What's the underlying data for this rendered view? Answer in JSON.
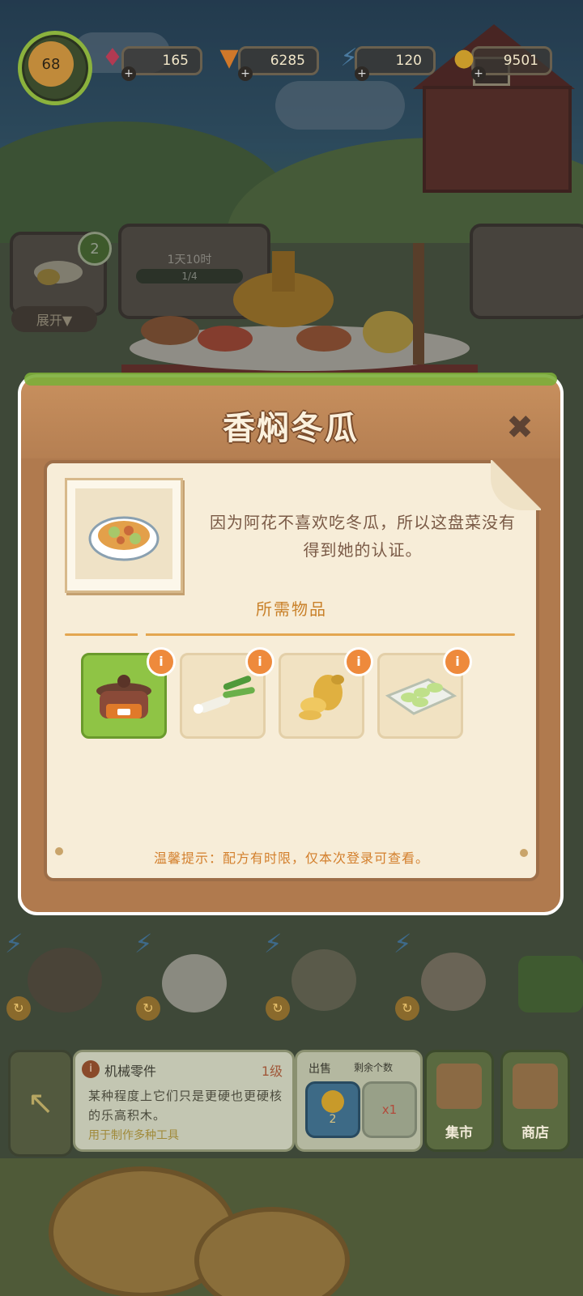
{
  "hud": {
    "level": "68",
    "gems": "165",
    "carrots": "6285",
    "energy": "120",
    "coins": "9501"
  },
  "background": {
    "expand_label": "展开▼",
    "notification_count": "2",
    "timer_text": "1天10时",
    "progress_text": "1/4"
  },
  "dialog": {
    "title": "香焖冬瓜",
    "close_icon": "close-icon",
    "dish_icon": "dish-icon",
    "description": "因为阿花不喜欢吃冬瓜，所以这盘菜没有得到她的认证。",
    "required_items_label": "所需物品",
    "required_items": [
      {
        "icon": "clay-pot-icon",
        "info": "i"
      },
      {
        "icon": "scallion-icon",
        "info": "i"
      },
      {
        "icon": "ginger-icon",
        "info": "i"
      },
      {
        "icon": "wintermelon-tray-icon",
        "info": "i"
      }
    ],
    "tip": "温馨提示：配方有时限，仅本次登录可查看。"
  },
  "bottom_panel": {
    "item_name": "机械零件",
    "item_level": "1级",
    "item_desc": "某种程度上它们只是更硬也更硬核的乐高积木。",
    "item_use": "用于制作多种工具",
    "sell_label": "出售",
    "remaining_label": "剩余个数",
    "sell_price": "2",
    "remaining_count": "x1",
    "market_label": "集市",
    "shop_label": "商店"
  },
  "colors": {
    "dialog_wood": "#b07a4e",
    "paper": "#f7edd8",
    "accent_orange": "#ee8a3c",
    "selected_green": "#8fc445"
  }
}
